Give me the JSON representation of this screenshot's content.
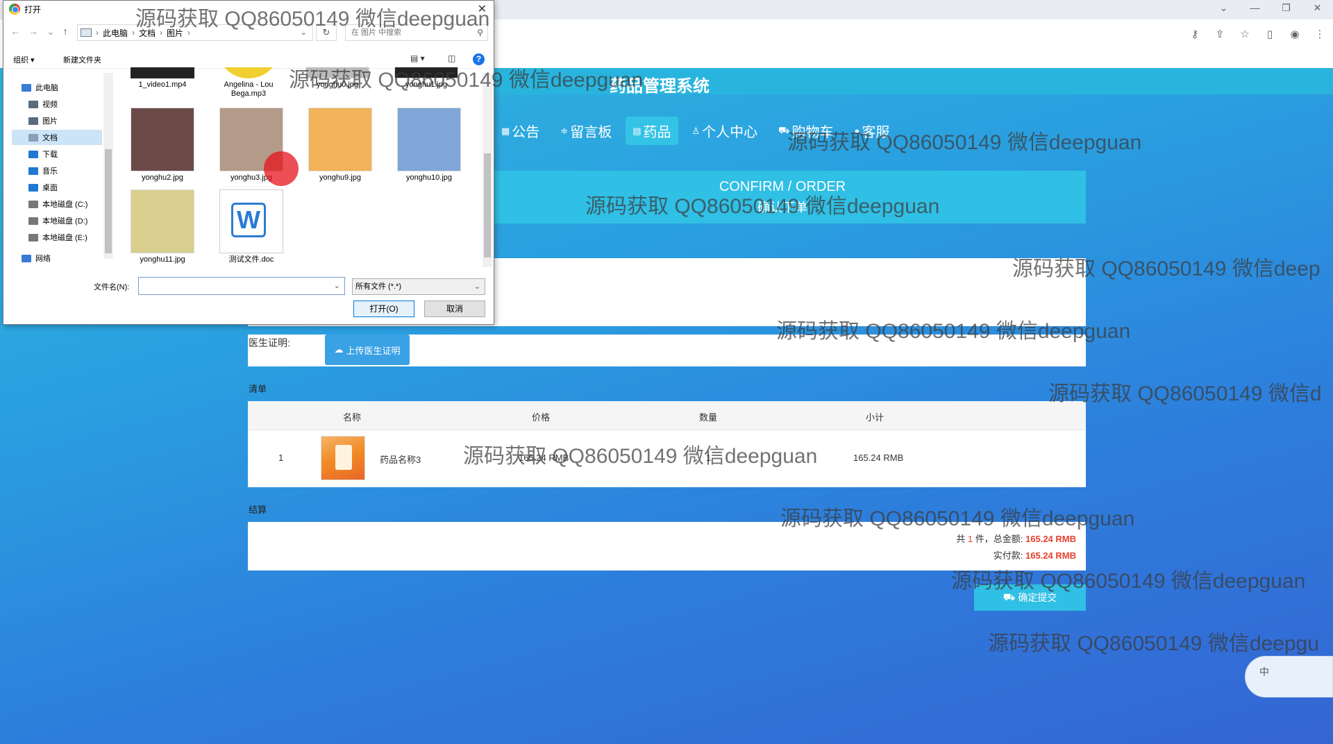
{
  "browser": {
    "controls": [
      "⌄",
      "—",
      "❐",
      "✕"
    ],
    "toolbar_icons": [
      "key-icon",
      "share-icon",
      "star-icon",
      "sidebar-icon",
      "profile-icon",
      "menu-icon"
    ]
  },
  "site": {
    "title": "药品管理系统",
    "nav": [
      {
        "icon": "▦",
        "label": "公告"
      },
      {
        "icon": "≑",
        "label": "留言板"
      },
      {
        "icon": "▤",
        "label": "药品",
        "active": true
      },
      {
        "icon": "♙",
        "label": "个人中心"
      },
      {
        "icon": "⛟",
        "label": "购物车"
      },
      {
        "icon": "●",
        "label": "客服"
      }
    ],
    "confirm_en": "CONFIRM / ORDER",
    "confirm_cn": "确认下单",
    "doctor_label": "医生证明:",
    "upload_label": "上传医生证明",
    "list_label": "清单",
    "table": {
      "headers": [
        "名称",
        "价格",
        "数量",
        "小计"
      ],
      "rows": [
        {
          "index": "1",
          "name": "药品名称3",
          "price": "165.24 RMB",
          "qty": "1",
          "subtotal": "165.24 RMB"
        }
      ]
    },
    "checkout_label": "结算",
    "summary": {
      "count_prefix": "共",
      "count": "1",
      "count_suffix": "件，总金额:",
      "total": "165.24 RMB",
      "paid_label": "实付款:",
      "paid": "165.24 RMB"
    },
    "submit_label": "确定提交",
    "ime_label": "中"
  },
  "dialog": {
    "title": "打开",
    "close": "✕",
    "path": [
      "此电脑",
      "文档",
      "图片"
    ],
    "search_placeholder": "在 图片 中搜索",
    "toolbar": {
      "organize": "组织 ▾",
      "new_folder": "新建文件夹"
    },
    "sidebar": [
      {
        "label": "此电脑",
        "color": "#3a7bd5"
      },
      {
        "label": "视频",
        "color": "#5a6b7d"
      },
      {
        "label": "图片",
        "color": "#5a6b7d"
      },
      {
        "label": "文档",
        "color": "#8aa0b8",
        "selected": true
      },
      {
        "label": "下载",
        "color": "#1f78d1"
      },
      {
        "label": "音乐",
        "color": "#1f78d1"
      },
      {
        "label": "桌面",
        "color": "#1f78d1"
      },
      {
        "label": "本地磁盘 (C:)",
        "color": "#777"
      },
      {
        "label": "本地磁盘 (D:)",
        "color": "#777"
      },
      {
        "label": "本地磁盘 (E:)",
        "color": "#777"
      },
      {
        "label": "网络",
        "color": "#3a7bd5"
      }
    ],
    "files_top": [
      "1_video1.mp4",
      "Angelina - Lou Bega.mp3",
      "yonghu0.jpg",
      "yonghu1.jpg"
    ],
    "files": [
      {
        "name": "yonghu2.jpg",
        "bg": "#6b4a48"
      },
      {
        "name": "yonghu3.jpg",
        "bg": "#b49a88"
      },
      {
        "name": "yonghu9.jpg",
        "bg": "#f2b35a"
      },
      {
        "name": "yonghu10.jpg",
        "bg": "#7fa6d6"
      },
      {
        "name": "yonghu11.jpg",
        "bg": "#d8cf8e"
      },
      {
        "name": "测试文件.doc",
        "bg": "#ffffff"
      }
    ],
    "filename_label": "文件名(N):",
    "filetype": "所有文件 (*.*)",
    "open_label": "打开(O)",
    "cancel_label": "取消"
  },
  "watermarks": [
    "源码获取 QQ86050149 微信deepguan",
    "源码获取 QQ86050149 微信deepguan",
    "源码获取 QQ86050149 微信deepguan",
    "源码获取 QQ86050149 微信deepguan",
    "源码获取 QQ86050149 微信deep",
    "源码获取 QQ86050149 微信deepguan",
    "源码获取 QQ86050149 微信d",
    "源码获取 QQ86050149 微信deepguan",
    "源码获取 QQ86050149 微信deepguan",
    "源码获取 QQ86050149 微信deepguan",
    "源码获取 QQ86050149 微信deepgu"
  ]
}
